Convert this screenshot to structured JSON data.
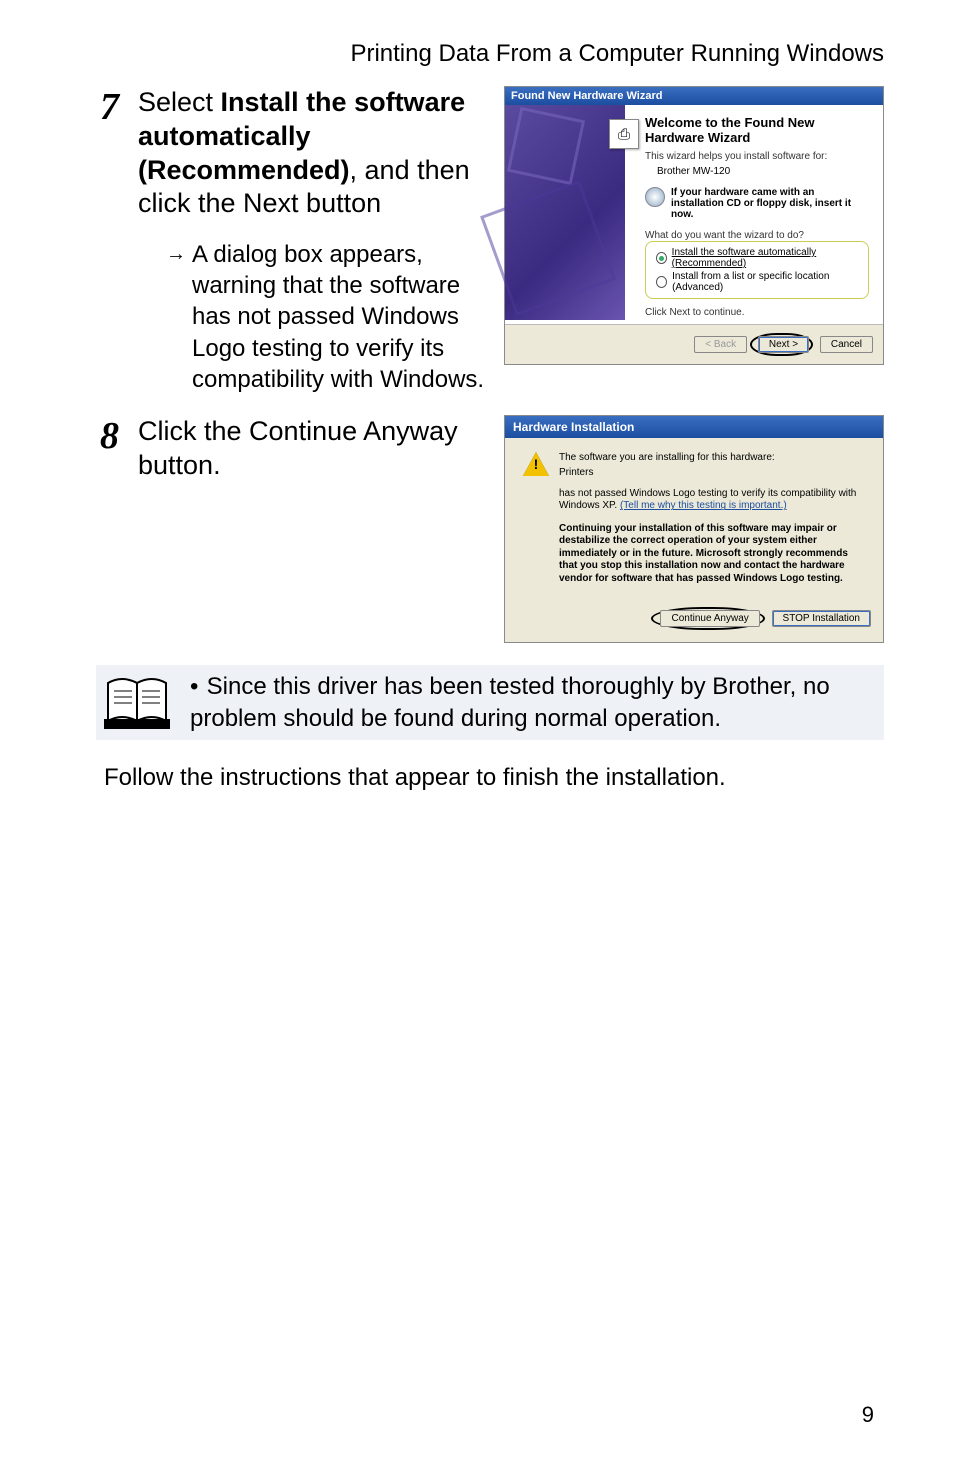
{
  "header": "Printing Data From a Computer Running Windows",
  "step7": {
    "num": "7",
    "pre": "Select ",
    "bold": "Install the software automatically (Recommended)",
    "post": ", and then click the Next button",
    "sub": "A dialog box appears, warning that the software has not passed Windows Logo testing to verify its compatibility with Windows."
  },
  "wizard": {
    "title": "Found New Hardware Wizard",
    "heading": "Welcome to the Found New Hardware Wizard",
    "intro": "This wizard helps you install software for:",
    "device": "Brother MW-120",
    "cd_text": "If your hardware came with an installation CD or floppy disk, insert it now.",
    "question": "What do you want the wizard to do?",
    "opt1": "Install the software automatically (Recommended)",
    "opt2": "Install from a list or specific location (Advanced)",
    "click_next": "Click Next to continue.",
    "btn_back": "< Back",
    "btn_next": "Next >",
    "btn_cancel": "Cancel"
  },
  "step8": {
    "num": "8",
    "text": "Click the Continue Anyway button."
  },
  "hwinst": {
    "title": "Hardware Installation",
    "line1": "The software you are installing for this hardware:",
    "line2": "Printers",
    "compat": "has not passed Windows Logo testing to verify its compatibility with Windows XP. ",
    "compat_link": "(Tell me why this testing is important.)",
    "warn": "Continuing your installation of this software may impair or destabilize the correct operation of your system either immediately or in the future. Microsoft strongly recommends that you stop this installation now and contact the hardware vendor for software that has passed Windows Logo testing.",
    "btn_continue": "Continue Anyway",
    "btn_stop": "STOP Installation"
  },
  "note": "Since this driver has been tested thoroughly by Brother, no problem should be found during normal operation.",
  "follow": "Follow the instructions that appear to finish the installation.",
  "page_number": "9"
}
